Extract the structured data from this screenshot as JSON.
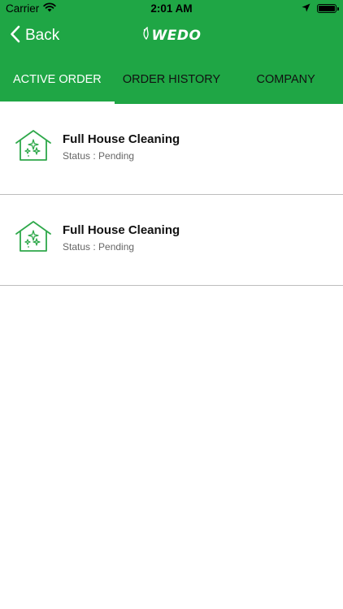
{
  "status_bar": {
    "carrier": "Carrier",
    "time": "2:01 AM"
  },
  "nav": {
    "back_label": "Back",
    "logo_text": "WEDO"
  },
  "tabs": [
    {
      "label": "ACTIVE ORDER",
      "active": true
    },
    {
      "label": "ORDER HISTORY",
      "active": false
    },
    {
      "label": "COMPANY",
      "active": false
    }
  ],
  "orders": [
    {
      "title": "Full House Cleaning",
      "status": "Status : Pending",
      "icon": "house-cleaning-icon"
    },
    {
      "title": "Full House Cleaning",
      "status": "Status : Pending",
      "icon": "house-cleaning-icon"
    }
  ],
  "colors": {
    "brand_green": "#1fa645",
    "icon_green": "#2ea84a",
    "divider": "#bdbdbd"
  }
}
